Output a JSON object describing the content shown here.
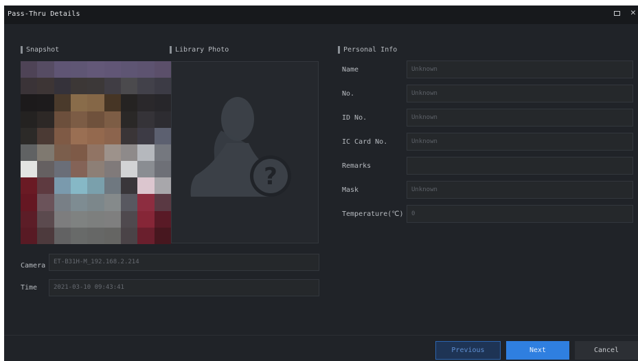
{
  "window": {
    "title": "Pass-Thru Details"
  },
  "sections": {
    "snapshot": "Snapshot",
    "library_photo": "Library Photo",
    "personal_info": "Personal Info"
  },
  "snapshot_info": {
    "camera_label": "Camera",
    "camera_value": "ET-B31H-M_192.168.2.214",
    "time_label": "Time",
    "time_value": "2021-03-10 09:43:41"
  },
  "personal_info": {
    "fields": [
      {
        "label": "Name",
        "value": "Unknown"
      },
      {
        "label": "No.",
        "value": "Unknown"
      },
      {
        "label": "ID No.",
        "value": "Unknown"
      },
      {
        "label": "IC Card No.",
        "value": "Unknown"
      },
      {
        "label": "Remarks",
        "value": ""
      },
      {
        "label": "Mask",
        "value": "Unknown"
      },
      {
        "label": "Temperature(℃)",
        "value": "0"
      }
    ]
  },
  "buttons": {
    "previous": "Previous",
    "next": "Next",
    "cancel": "Cancel"
  },
  "icons": {
    "maximize": "maximize-icon",
    "close": "close-icon",
    "library_placeholder": "unknown-person-icon",
    "snapshot": "pixelated-face-snapshot"
  },
  "colors": {
    "window_bg": "#202328",
    "title_bar": "#17191c",
    "accent": "#2f7fe0",
    "input_bg": "#25282b"
  }
}
